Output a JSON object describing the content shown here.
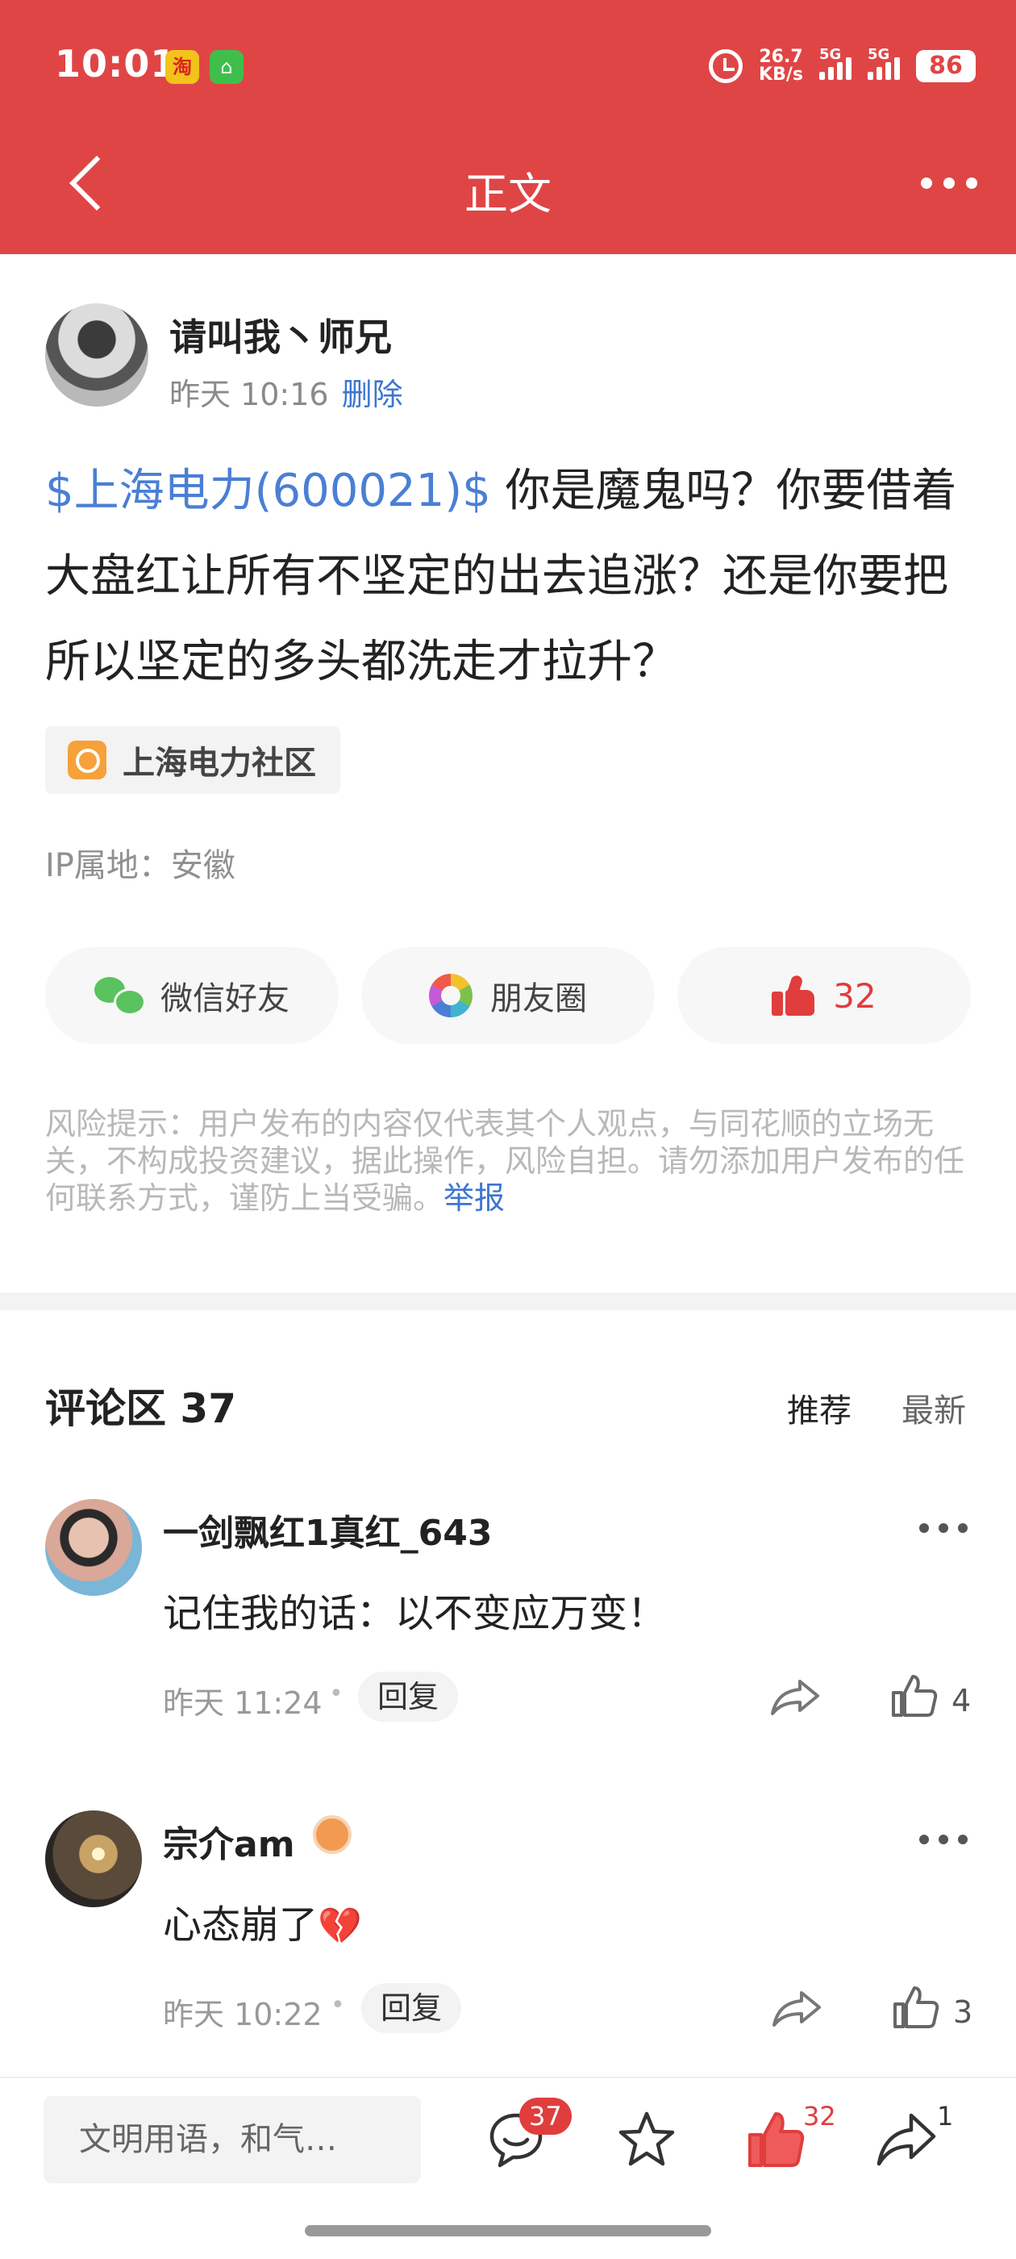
{
  "status_bar": {
    "time": "10:01",
    "speed_top": "26.7",
    "speed_bottom": "KB/s",
    "net1": "5G",
    "net2": "5G",
    "battery": "86"
  },
  "nav": {
    "title": "正文"
  },
  "post": {
    "author": "请叫我丶师兄",
    "time": "昨天 10:16",
    "delete_label": "删除",
    "stock_tag": "$上海电力(600021)$",
    "content": " 你是魔鬼吗？你要借着大盘红让所有不坚定的出去追涨？还是你要把所以坚定的多头都洗走才拉升？",
    "community": "上海电力社区",
    "ip": "IP属地：安徽",
    "share_wechat": "微信好友",
    "share_moments": "朋友圈",
    "likes": "32",
    "risk_text": "风险提示：用户发布的内容仅代表其个人观点，与同花顺的立场无关，不构成投资建议，据此操作，风险自担。请勿添加用户发布的任何联系方式，谨防上当受骗。",
    "report_label": "举报"
  },
  "comments_section": {
    "title": "评论区 37",
    "sort_recommended": "推荐",
    "sort_latest": "最新",
    "items": [
      {
        "name": "一剑飘红1真红_643",
        "text": "记住我的话：以不变应万变！",
        "time": "昨天 11:24",
        "reply": "回复",
        "likes": "4"
      },
      {
        "name": "宗介am",
        "text": "心态崩了",
        "emoji": "💔",
        "time": "昨天 10:22",
        "reply": "回复",
        "likes": "3"
      }
    ]
  },
  "bottom_bar": {
    "input_placeholder": "文明用语，和气…",
    "comment_count": "37",
    "like_count": "32",
    "share_count": "1"
  }
}
